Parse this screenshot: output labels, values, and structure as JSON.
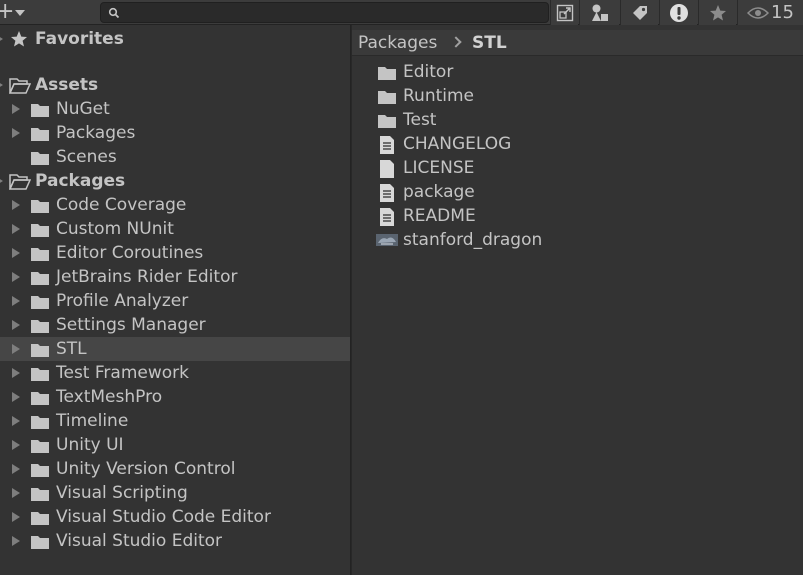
{
  "toolbar": {
    "search": {
      "value": "",
      "placeholder": ""
    },
    "hidden_count": "15",
    "icons": [
      "create-add-icon",
      "search-icon",
      "open-window-icon",
      "type-filter-icon",
      "label-filter-icon",
      "log-filter-icon",
      "favorite-star-icon",
      "visibility-eye-icon"
    ]
  },
  "tree": {
    "favorites": "Favorites",
    "assets": {
      "label": "Assets",
      "children": [
        "NuGet",
        "Packages",
        "Scenes"
      ]
    },
    "packages": {
      "label": "Packages",
      "children": [
        "Code Coverage",
        "Custom NUnit",
        "Editor Coroutines",
        "JetBrains Rider Editor",
        "Profile Analyzer",
        "Settings Manager",
        "STL",
        "Test Framework",
        "TextMeshPro",
        "Timeline",
        "Unity UI",
        "Unity Version Control",
        "Visual Scripting",
        "Visual Studio Code Editor",
        "Visual Studio Editor"
      ],
      "selected": "STL"
    }
  },
  "breadcrumb": {
    "root": "Packages",
    "current": "STL"
  },
  "contents": [
    {
      "name": "Editor",
      "type": "folder"
    },
    {
      "name": "Runtime",
      "type": "folder"
    },
    {
      "name": "Test",
      "type": "folder"
    },
    {
      "name": "CHANGELOG",
      "type": "text"
    },
    {
      "name": "LICENSE",
      "type": "blank"
    },
    {
      "name": "package",
      "type": "text"
    },
    {
      "name": "README",
      "type": "text"
    },
    {
      "name": "stanford_dragon",
      "type": "mesh"
    }
  ],
  "colors": {
    "panel": "#333333",
    "selected_row": "#464646",
    "toolbar": "#3c3c3c",
    "text": "#c4c4c4"
  }
}
